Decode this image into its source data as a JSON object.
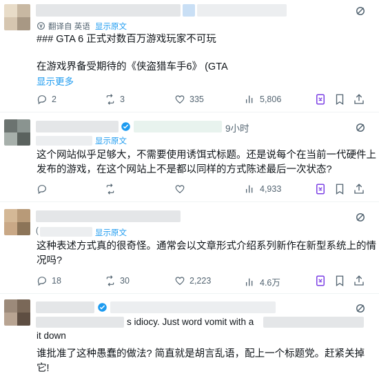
{
  "posts": [
    {
      "translate_label": "翻译自 英语",
      "show_original": "显示原文",
      "line1": "### GTA 6 正式对数百万游戏玩家不可玩",
      "line2": "在游戏界备受期待的《侠盗猎车手6》 (GTA",
      "show_more": "显示更多",
      "replies": "2",
      "retweets": "3",
      "likes": "335",
      "views": "5,806"
    },
    {
      "time": "9小时",
      "show_original": "显示原文",
      "line1": "这个网站似乎足够大，不需要使用诱饵式标题。还是说每个在当前一代硬件上",
      "line2": "发布的游戏，在这个网站上不是都以同样的方式陈述最后一次状态?",
      "replies": "",
      "retweets": "",
      "likes": "",
      "views": "4,933"
    },
    {
      "prefix": "(",
      "show_original": "显示原文",
      "line1": "这种表述方式真的很奇怪。通常会以文章形式介绍系列新作在新型系统上的情",
      "line2": "况吗?",
      "replies": "18",
      "retweets": "30",
      "likes": "2,223",
      "views": "4.6万"
    },
    {
      "orig_line1": "s idiocy. Just word vomit with a",
      "orig_line2": "it down",
      "line1": "谁批准了这种愚蠢的做法? 简直就是胡言乱语，配上一个标题党。赶紧关掉",
      "line2": "它!"
    }
  ],
  "colors": {
    "accent": "#1d9bf0",
    "muted": "#536471",
    "text": "#0f1419"
  },
  "icons": [
    "translate-icon",
    "reply-icon",
    "retweet-icon",
    "like-icon",
    "views-icon",
    "grok-icon",
    "bookmark-icon",
    "share-icon",
    "more-icon",
    "verified-icon"
  ]
}
